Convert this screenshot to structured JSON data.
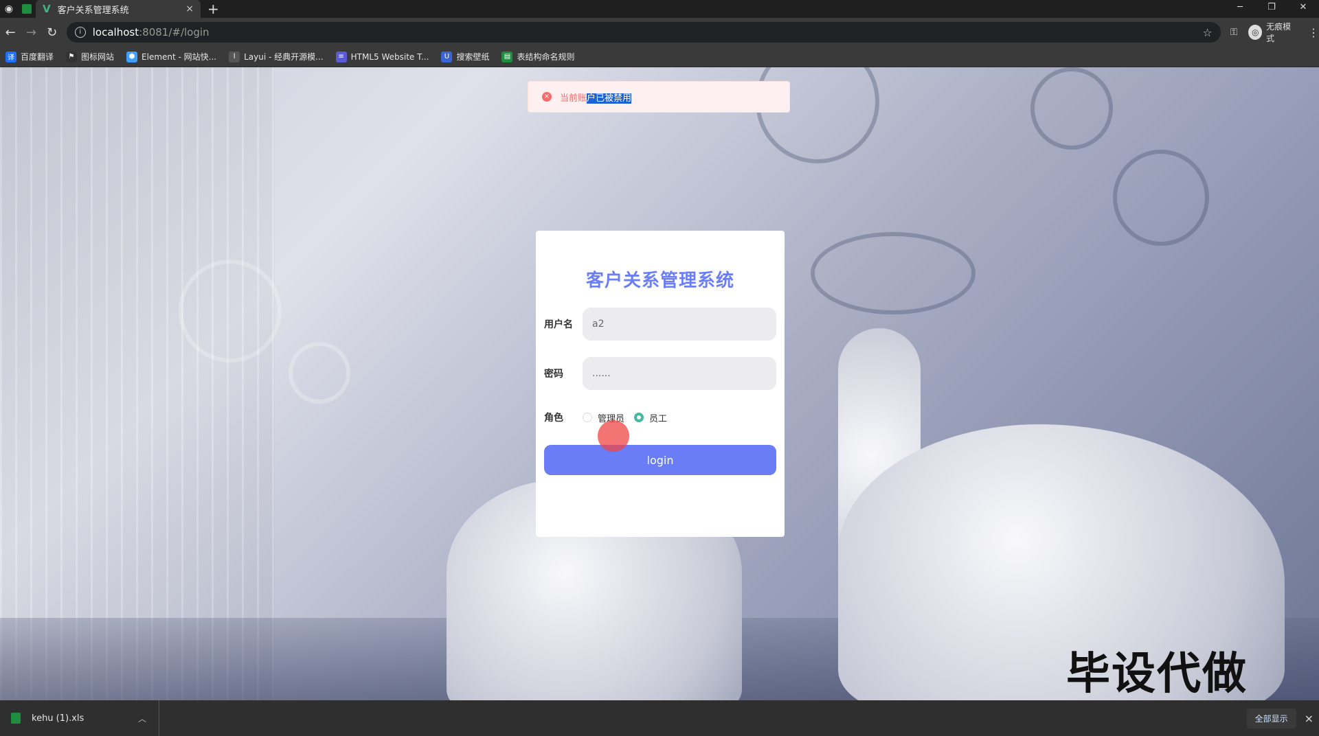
{
  "browser": {
    "tab_title": "客户关系管理系统",
    "tab_close": "×",
    "new_tab": "+",
    "url_host": "localhost",
    "url_path": ":8081/#/login",
    "incognito_label": "无痕模式",
    "bookmarks": [
      {
        "label": "百度翻译",
        "color": "#1e6fff",
        "icon": "译"
      },
      {
        "label": "图标网站",
        "color": "#333333",
        "icon": "⚑"
      },
      {
        "label": "Element - 网站快...",
        "color": "#409eff",
        "icon": "⬢"
      },
      {
        "label": "Layui - 经典开源模...",
        "color": "#555555",
        "icon": "l"
      },
      {
        "label": "HTML5 Website T...",
        "color": "#5b5bd6",
        "icon": "≡"
      },
      {
        "label": "搜索壁纸",
        "color": "#3a64d8",
        "icon": "U"
      },
      {
        "label": "表结构命名规则",
        "color": "#1e8e3e",
        "icon": "▤"
      }
    ]
  },
  "toast": {
    "message_plain": "当前账",
    "message_selected": "户已被禁用",
    "icon": "×",
    "color": "#f56c6c"
  },
  "login": {
    "title": "客户关系管理系统",
    "username_label": "用户名",
    "username_value": "a2",
    "password_label": "密码",
    "password_value": "......",
    "role_label": "角色",
    "roles": [
      {
        "label": "管理员",
        "checked": false
      },
      {
        "label": "员工",
        "checked": true
      }
    ],
    "button_label": "login",
    "accent_color": "#6a7cf6"
  },
  "watermark": "毕设代做",
  "download_bar": {
    "file_name": "kehu (1).xls",
    "show_all_label": "全部显示",
    "close": "×"
  }
}
